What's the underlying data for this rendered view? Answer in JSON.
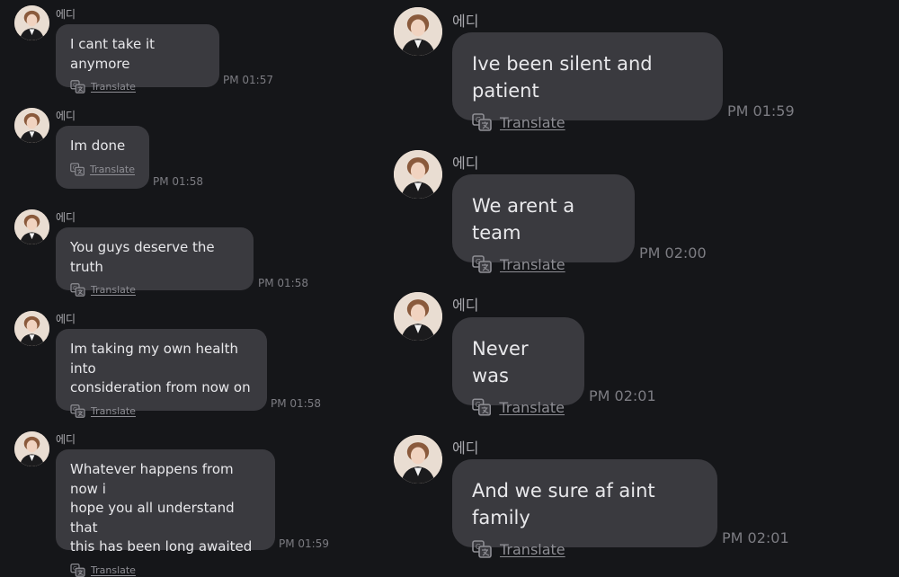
{
  "sender": "에디",
  "translate_label": "Translate",
  "left_messages": [
    {
      "text": "I cant take it anymore",
      "time": "PM 01:57"
    },
    {
      "text": "Im done",
      "time": "PM 01:58"
    },
    {
      "text": "You guys deserve the truth",
      "time": "PM 01:58"
    },
    {
      "text": "Im taking my own health into\nconsideration from now on",
      "time": "PM 01:58"
    },
    {
      "text": "Whatever happens from now i\nhope you all understand that\nthis has been long awaited",
      "time": "PM 01:59"
    }
  ],
  "right_messages": [
    {
      "text": "Ive been silent and patient",
      "time": "PM 01:59"
    },
    {
      "text": "We arent a team",
      "time": "PM 02:00"
    },
    {
      "text": "Never was",
      "time": "PM 02:01"
    },
    {
      "text": "And we sure af aint family",
      "time": "PM 02:01"
    }
  ],
  "icons": {
    "avatar": "profile-photo",
    "translate": "translate-icon"
  },
  "colors": {
    "background": "#151619",
    "bubble": "#3a3a3f",
    "text": "#e8e8eb",
    "muted": "#7c7c82"
  }
}
